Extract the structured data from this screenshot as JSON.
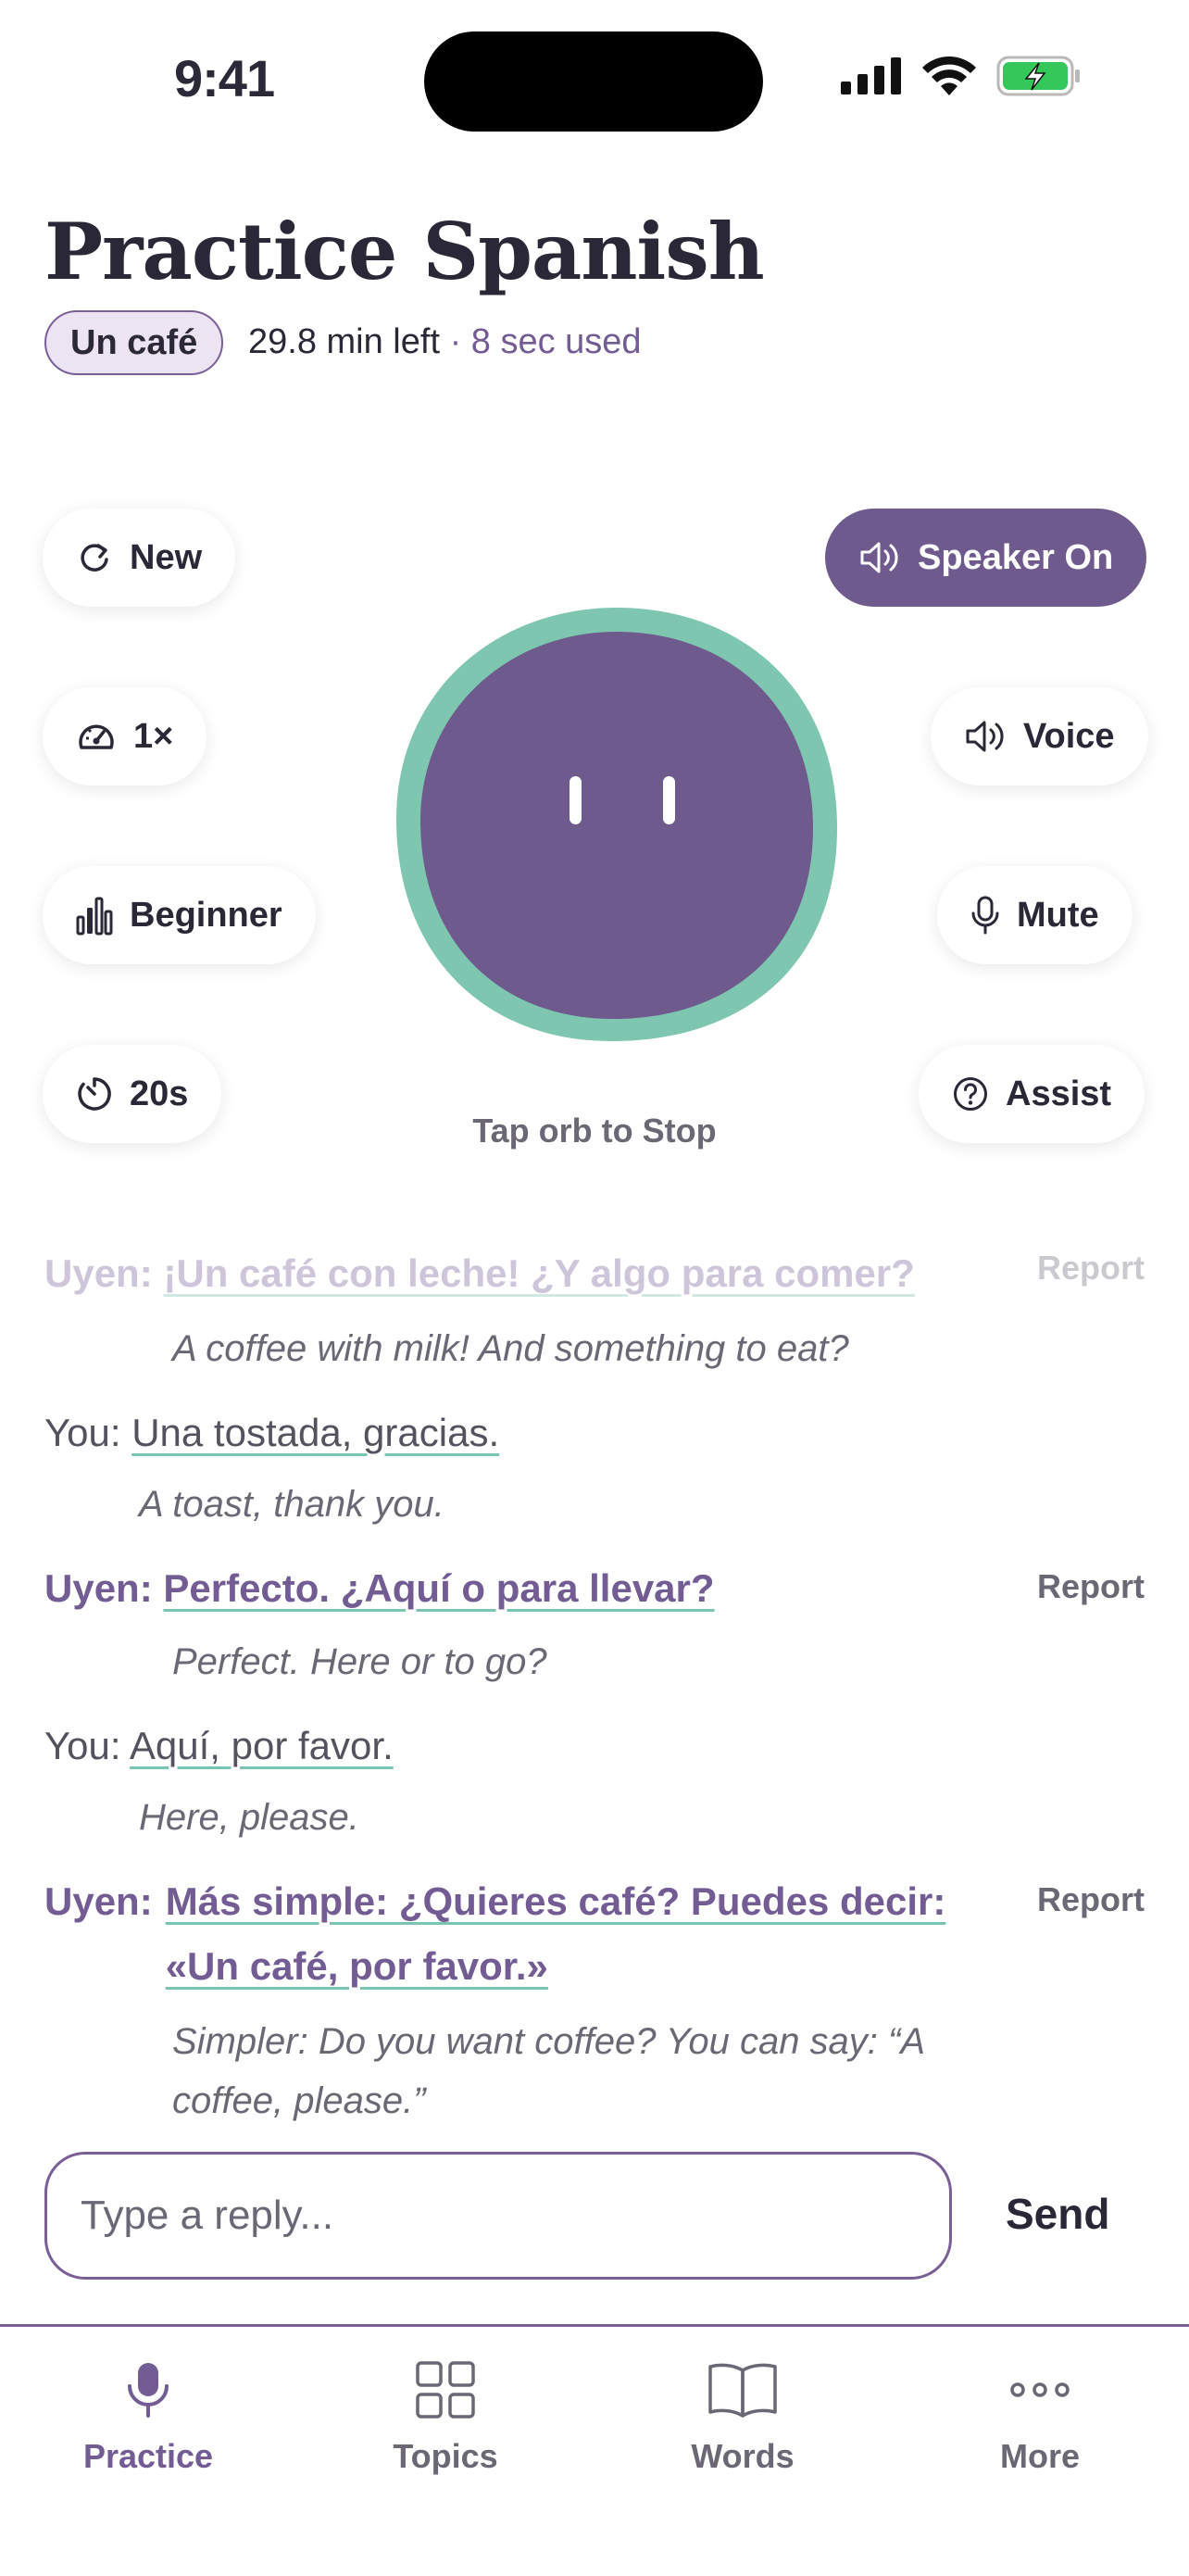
{
  "status_bar": {
    "time": "9:41"
  },
  "header": {
    "title": "Practice Spanish",
    "topic": "Un café",
    "time_left": "29.8 min left",
    "separator": "·",
    "time_used": "8 sec used"
  },
  "controls": {
    "new_label": "New",
    "speed_label": "1×",
    "level_label": "Beginner",
    "timer_label": "20s",
    "speaker_label": "Speaker On",
    "voice_label": "Voice",
    "mute_label": "Mute",
    "assist_label": "Assist",
    "orb_hint": "Tap orb to Stop"
  },
  "transcript": [
    {
      "speaker": "Uyen:",
      "text": "¡Un café con leche! ¿Y algo para comer?",
      "translation": "A coffee with milk! And something to eat?",
      "report": "Report"
    },
    {
      "speaker": "You:",
      "text": "Una tostada, gracias.",
      "translation": "A toast, thank you."
    },
    {
      "speaker": "Uyen:",
      "text": "Perfecto. ¿Aquí o para llevar?",
      "translation": "Perfect. Here or to go?",
      "report": "Report"
    },
    {
      "speaker": "You:",
      "text": "Aquí, por favor.",
      "translation": "Here, please."
    },
    {
      "speaker": "Uyen:",
      "text": "Más simple: ¿Quieres café? Puedes decir: «Un café, por favor.»",
      "translation": "Simpler: Do you want coffee? You can say: “A coffee, please.”",
      "report": "Report"
    }
  ],
  "input": {
    "placeholder": "Type a reply...",
    "send_label": "Send"
  },
  "tabs": [
    {
      "label": "Practice",
      "icon": "mic-icon"
    },
    {
      "label": "Topics",
      "icon": "grid-icon"
    },
    {
      "label": "Words",
      "icon": "book-icon"
    },
    {
      "label": "More",
      "icon": "ellipsis-icon"
    }
  ],
  "colors": {
    "accent": "#6f5a8e",
    "orb_ring": "#7ec6b0",
    "badge_bg": "#ece3f3"
  }
}
